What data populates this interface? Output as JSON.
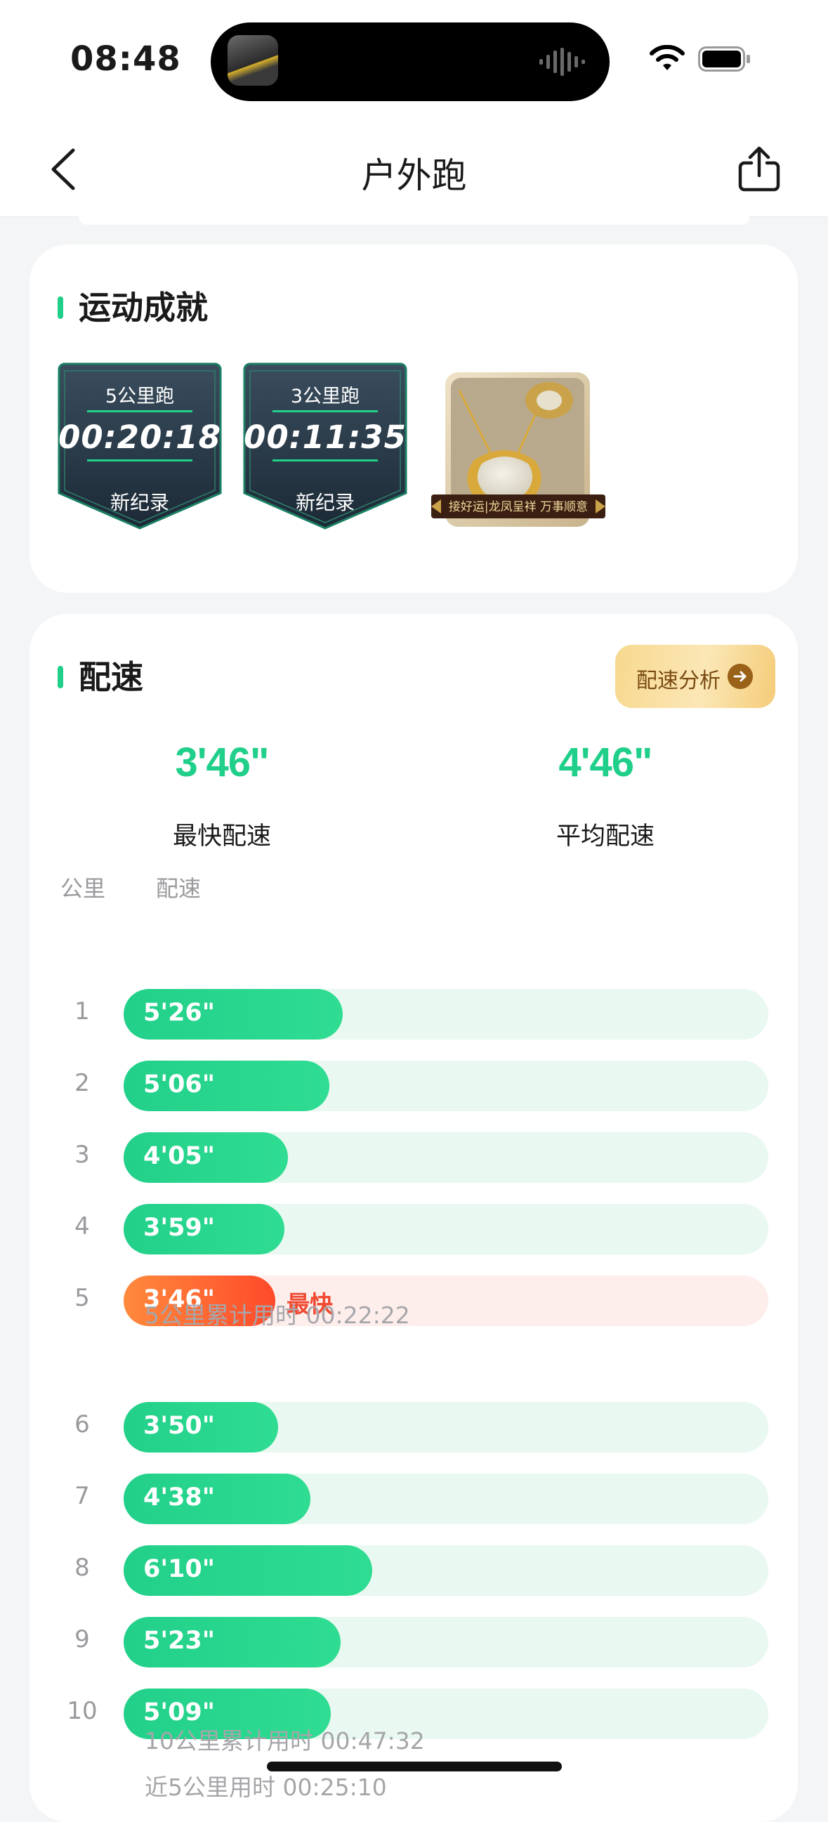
{
  "status_bar": {
    "time": "08:48"
  },
  "nav": {
    "title": "户外跑"
  },
  "achievements": {
    "title": "运动成就",
    "badges": [
      {
        "label": "5公里跑",
        "time": "00:20:18",
        "record": "新纪录"
      },
      {
        "label": "3公里跑",
        "time": "00:11:35",
        "record": "新纪录"
      }
    ],
    "medal_ribbon": "接好运|龙凤呈祥 万事顺意"
  },
  "pace": {
    "title": "配速",
    "analysis_button": "配速分析",
    "fastest_value": "3'46\"",
    "fastest_label": "最快配速",
    "average_value": "4'46\"",
    "average_label": "平均配速",
    "col_km": "公里",
    "col_pace": "配速",
    "fast_tag": "最快",
    "splits": [
      {
        "km": "1",
        "pace": "5'26\"",
        "seconds": 326
      },
      {
        "km": "2",
        "pace": "5'06\"",
        "seconds": 306
      },
      {
        "km": "3",
        "pace": "4'05\"",
        "seconds": 245
      },
      {
        "km": "4",
        "pace": "3'59\"",
        "seconds": 239
      },
      {
        "km": "5",
        "pace": "3'46\"",
        "seconds": 226,
        "fastest": true
      },
      {
        "km": "6",
        "pace": "3'50\"",
        "seconds": 230
      },
      {
        "km": "7",
        "pace": "4'38\"",
        "seconds": 278
      },
      {
        "km": "8",
        "pace": "6'10\"",
        "seconds": 370
      },
      {
        "km": "9",
        "pace": "5'23\"",
        "seconds": 323
      },
      {
        "km": "10",
        "pace": "5'09\"",
        "seconds": 309
      }
    ],
    "note_5km": "5公里累计用时 00:22:22",
    "note_10km": "10公里累计用时 00:47:32",
    "note_last5": "近5公里用时 00:25:10"
  },
  "colors": {
    "accent": "#20cf89",
    "fast": "#ff4a2a",
    "track": "#e9f8f0"
  }
}
